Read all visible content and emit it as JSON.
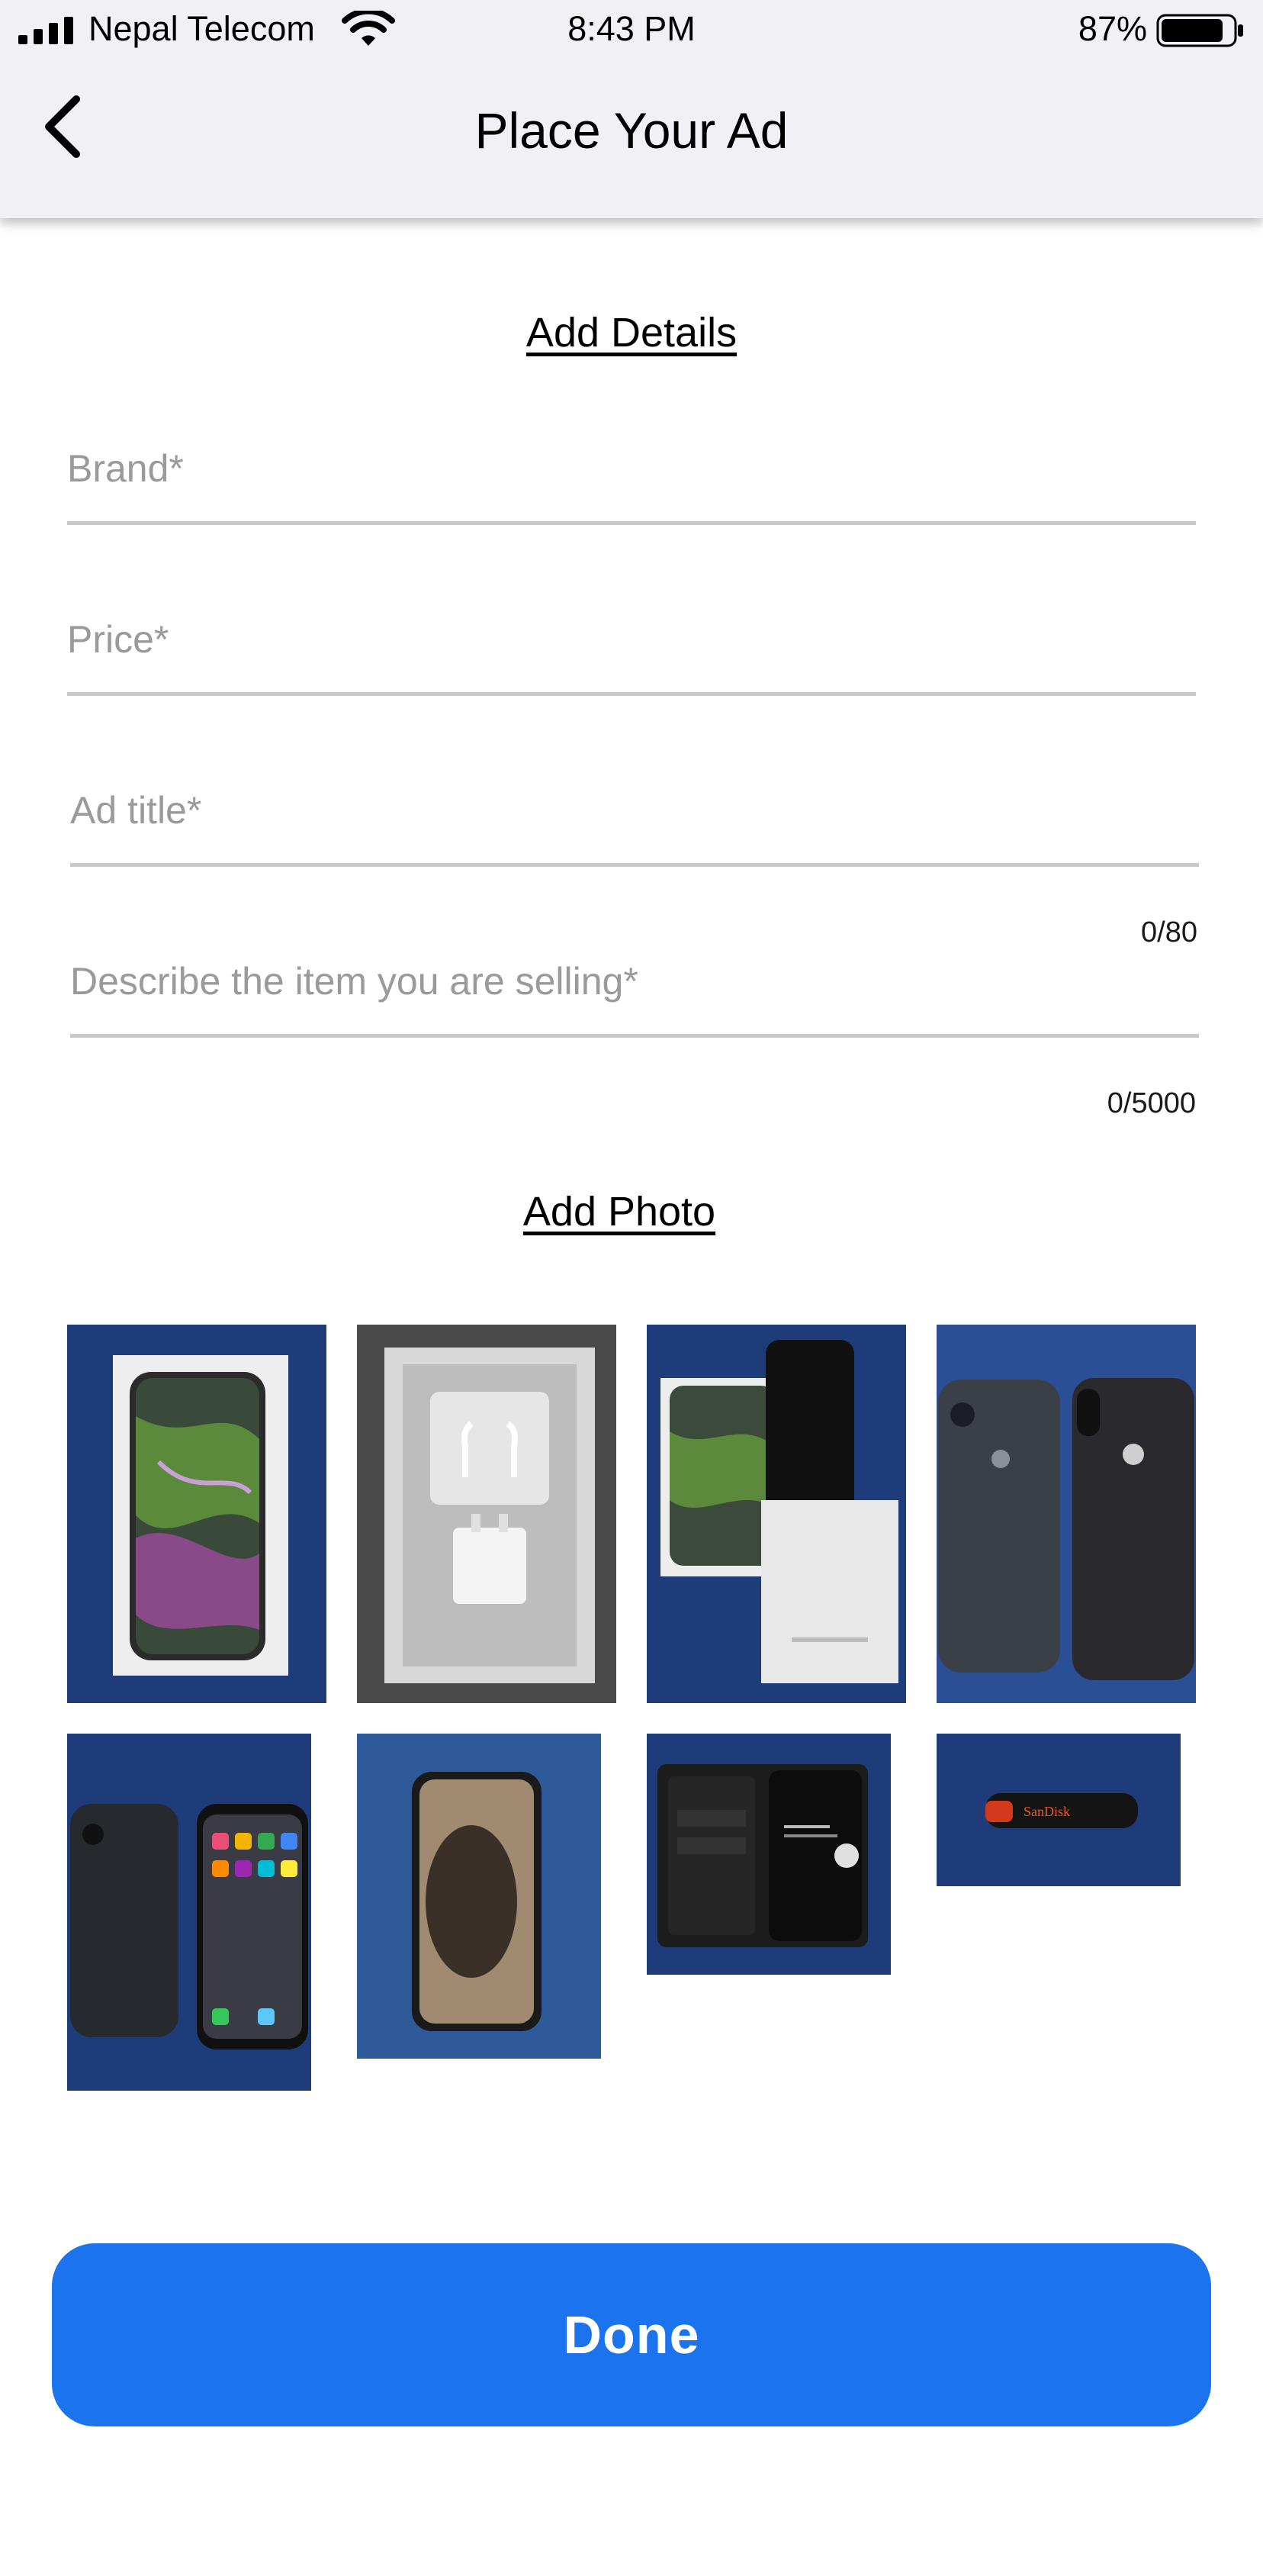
{
  "status_bar": {
    "carrier": "Nepal Telecom",
    "time": "8:43 PM",
    "battery_percent": "87%",
    "battery_level": 0.87,
    "signal_icon": "cellular-signal-icon",
    "wifi_icon": "wifi-icon",
    "battery_icon": "battery-icon"
  },
  "nav": {
    "title": "Place Your Ad",
    "back_icon": "chevron-left-icon"
  },
  "details": {
    "heading": "Add Details",
    "fields": {
      "brand": {
        "placeholder": "Brand*",
        "value": ""
      },
      "price": {
        "placeholder": "Price*",
        "value": ""
      },
      "title": {
        "placeholder": "Ad title*",
        "value": "",
        "counter": "0/80"
      },
      "description": {
        "placeholder": "Describe the item you are selling*",
        "value": "",
        "counter": "0/5000"
      }
    }
  },
  "photos": {
    "heading": "Add Photo",
    "items": [
      {
        "subject": "iphone-box-front"
      },
      {
        "subject": "open-box-earphones-charger"
      },
      {
        "subject": "box-with-phone"
      },
      {
        "subject": "phone-back-with-case"
      },
      {
        "subject": "phone-case-and-home-screen"
      },
      {
        "subject": "phone-screen-reflection"
      },
      {
        "subject": "wallet-case-open"
      },
      {
        "subject": "usb-flash-drive",
        "label": "SanDisk"
      }
    ]
  },
  "actions": {
    "done_label": "Done"
  },
  "colors": {
    "primary": "#1b73ee",
    "header_bg": "#f1f1f5",
    "placeholder": "#9a9a9a",
    "underline": "#c9c9c9",
    "carpet_blue": "#1e3c7a"
  }
}
